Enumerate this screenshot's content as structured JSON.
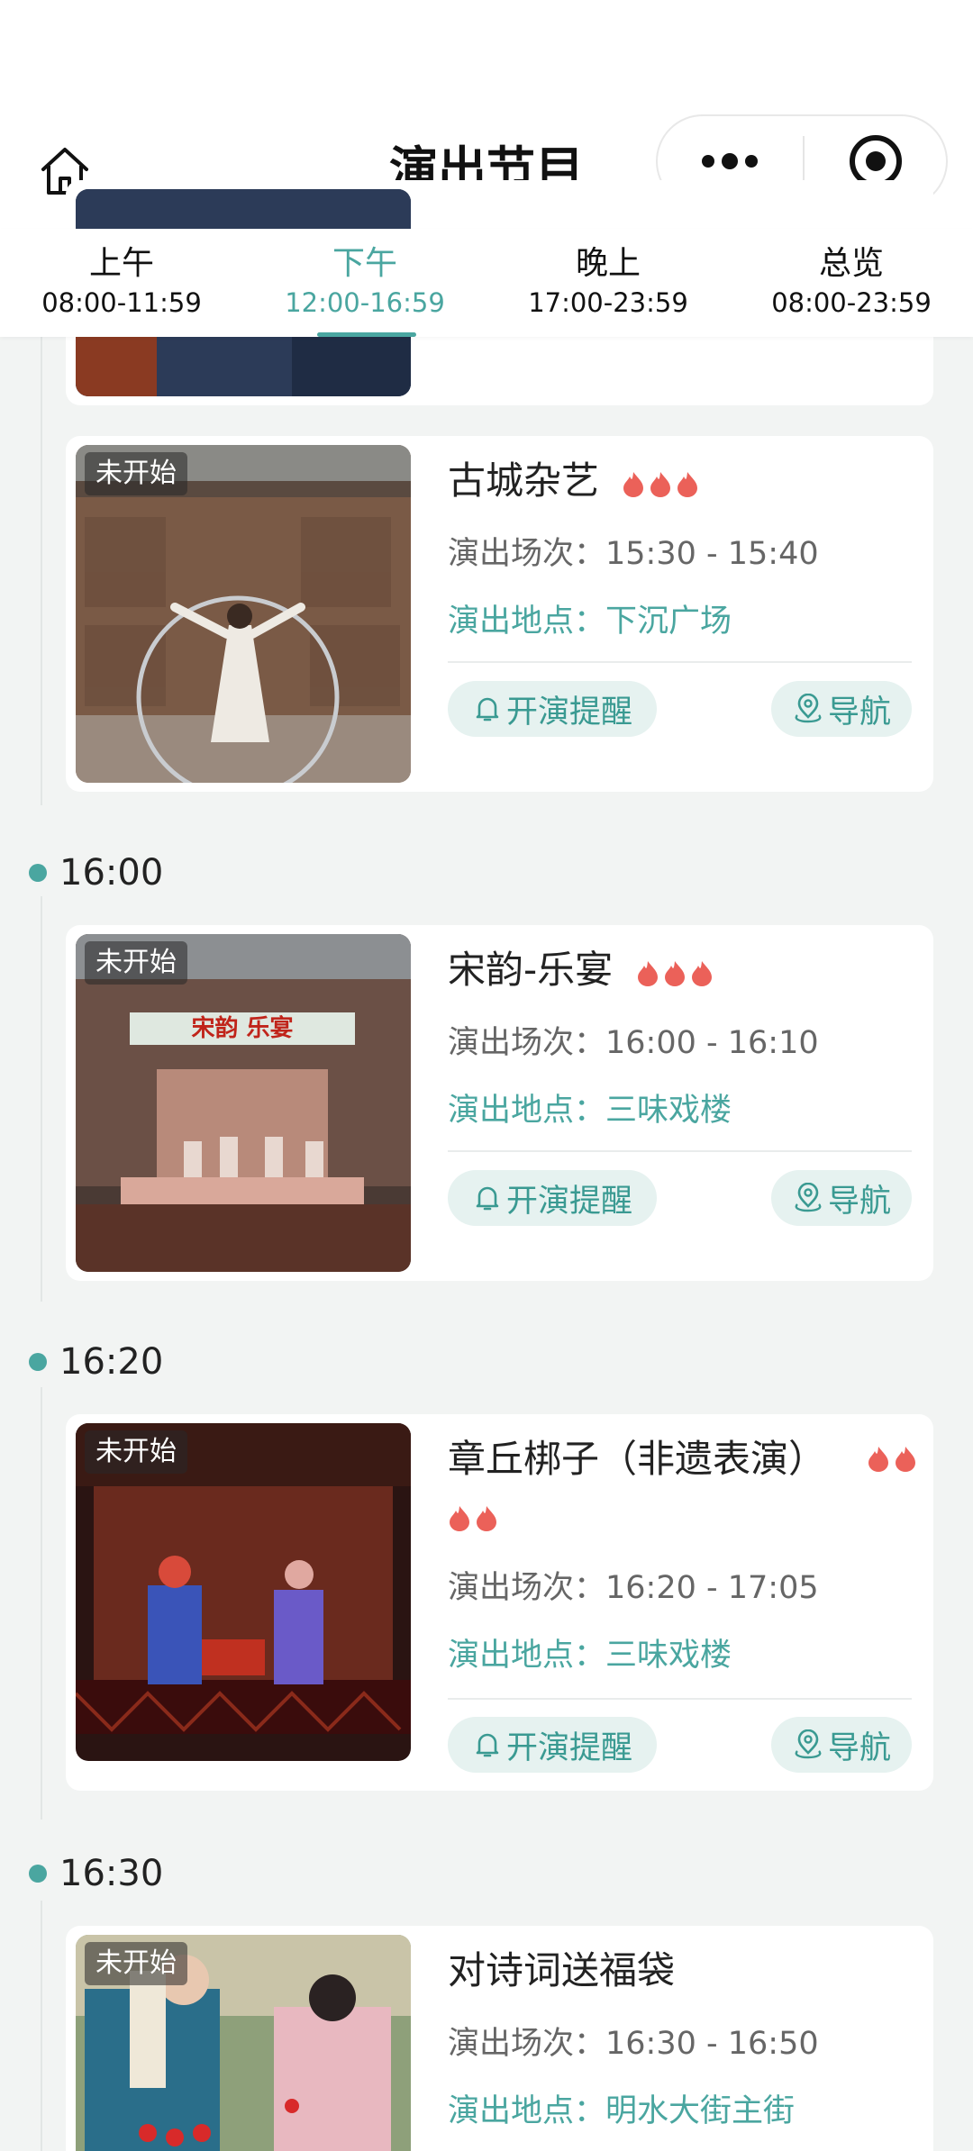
{
  "header": {
    "title": "演出节目"
  },
  "tabs": [
    {
      "label": "上午",
      "range": "08:00-11:59"
    },
    {
      "label": "下午",
      "range": "12:00-16:59"
    },
    {
      "label": "晚上",
      "range": "17:00-23:59"
    },
    {
      "label": "总览",
      "range": "08:00-23:59"
    }
  ],
  "active_tab": "下午",
  "labels": {
    "time_prefix": "演出场次：",
    "place_prefix": "演出地点：",
    "remind": "开演提醒",
    "navigate": "导航",
    "status": "未开始"
  },
  "times": [
    "16:00",
    "16:20",
    "16:30"
  ],
  "shows": [
    {
      "title": "古城杂艺",
      "heat": 3,
      "status": "未开始",
      "session": "15:30 - 15:40",
      "location": "下沉广场"
    },
    {
      "title": "宋韵-乐宴",
      "heat": 3,
      "status": "未开始",
      "session": "16:00 - 16:10",
      "location": "三味戏楼",
      "banner": "宋韵 乐宴"
    },
    {
      "title": "章丘梆子（非遗表演）",
      "heat": 4,
      "status": "未开始",
      "session": "16:20 - 17:05",
      "location": "三味戏楼"
    },
    {
      "title": "对诗词送福袋",
      "status": "未开始",
      "session": "16:30 - 16:50",
      "location": "明水大街主街"
    }
  ],
  "colors": {
    "accent": "#4aa6a0",
    "button_bg": "#e6f2f0",
    "flame": "#e8453c",
    "background": "#f2f4f3"
  },
  "icons": [
    "home-icon",
    "more-dots-icon",
    "target-icon",
    "bell-icon",
    "location-pin-icon",
    "flame-icon"
  ]
}
